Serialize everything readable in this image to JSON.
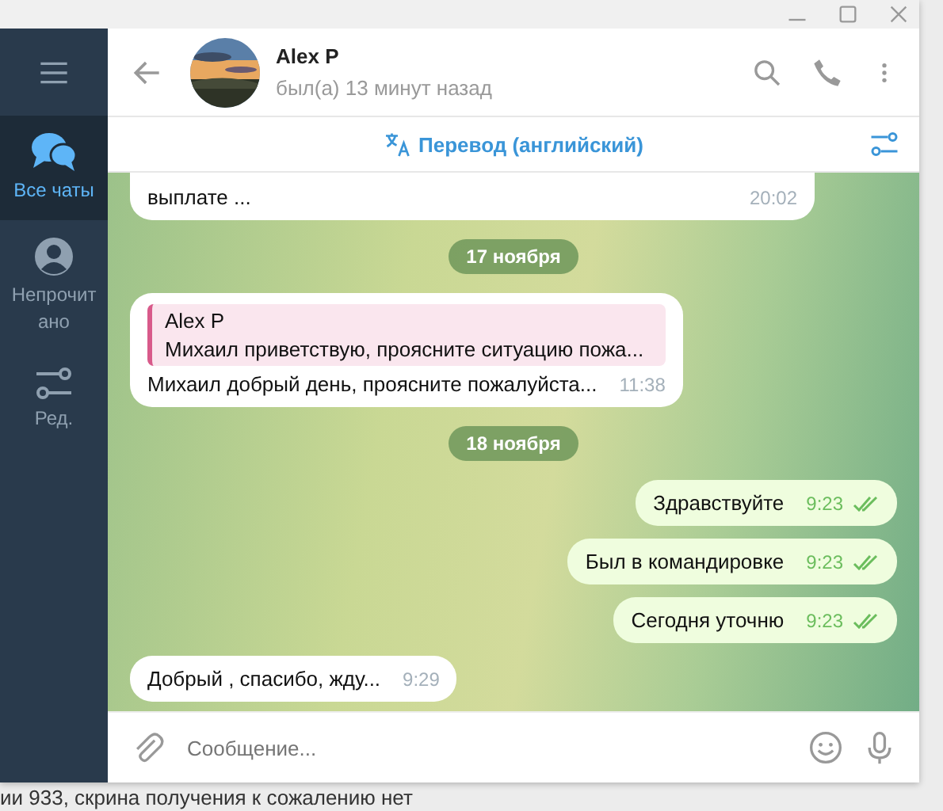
{
  "chat": {
    "name": "Alex P",
    "status": "был(а) 13 минут назад"
  },
  "sidebar": {
    "items": [
      {
        "kind": "chats",
        "label": "Все чаты",
        "selected": true
      },
      {
        "kind": "unread",
        "label": "Непрочитано",
        "selected": false
      },
      {
        "kind": "edit",
        "label": "Ред.",
        "selected": false
      }
    ]
  },
  "translate_bar": {
    "label": "Перевод (английский)"
  },
  "messages": [
    {
      "kind": "incoming",
      "text": "выплате ...",
      "time": "20:02",
      "clipped": true
    },
    {
      "kind": "date",
      "text": "17 ноября"
    },
    {
      "kind": "incoming",
      "text": "Михаил добрый день, проясните пожалуйста...",
      "time": "11:38",
      "reply": {
        "author": "Alex P",
        "text": "Михаил приветствую, проясните ситуацию пожа..."
      }
    },
    {
      "kind": "date",
      "text": "18 ноября"
    },
    {
      "kind": "outgoing",
      "text": "Здравствуйте",
      "time": "9:23",
      "read": true
    },
    {
      "kind": "outgoing",
      "text": "Был в командировке",
      "time": "9:23",
      "read": true
    },
    {
      "kind": "outgoing",
      "text": "Сегодня уточню",
      "time": "9:23",
      "read": true
    },
    {
      "kind": "incoming",
      "text": "Добрый , спасибо, жду...",
      "time": "9:29"
    }
  ],
  "composer": {
    "placeholder": "Сообщение..."
  },
  "background_text": "ии 933, скрина получения к сожалению нет"
}
